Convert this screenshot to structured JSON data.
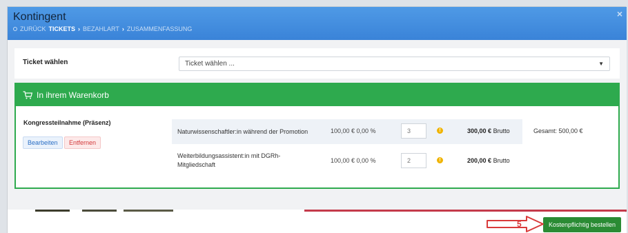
{
  "header": {
    "title": "Kontingent",
    "breadcrumb": {
      "back": "ZURÜCK",
      "step1": "TICKETS",
      "step2": "BEZAHLART",
      "step3": "ZUSAMMENFASSUNG"
    },
    "close": "×"
  },
  "ticket": {
    "label": "Ticket wählen",
    "select_value": "Ticket wählen ..."
  },
  "cart": {
    "title": "In ihrem Warenkorb",
    "product": "Kongressteilnahme (Präsenz)",
    "edit": "Bearbeiten",
    "remove": "Entfernen",
    "total": "Gesamt: 500,00 €",
    "items": [
      {
        "desc": "Naturwissenschaftler:in während der Promotion",
        "price": "100,00 € 0,00 %",
        "qty": "3",
        "sum": "300,00 €",
        "suffix": "Brutto"
      },
      {
        "desc": "Weiterbildungsassistent:in mit DGRh-Mitgliedschaft",
        "price": "100,00 € 0,00 %",
        "qty": "2",
        "sum": "200,00 €",
        "suffix": "Brutto"
      }
    ]
  },
  "footer": {
    "order": "Kostenpflichtig bestellen",
    "step": "5"
  },
  "colors": {
    "header_blue": "#3a83d8",
    "cart_green": "#2eaa4e",
    "order_green": "#2a8b34",
    "arrow_red": "#d93a3a"
  },
  "icons": {
    "cart": "shopping-cart-icon",
    "warn": "warning-icon"
  }
}
